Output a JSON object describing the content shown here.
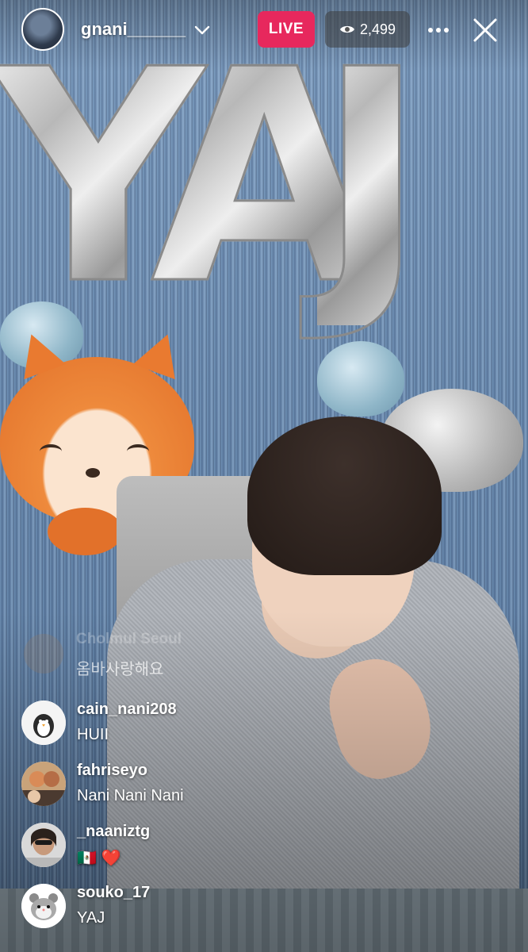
{
  "header": {
    "host_username": "gnani______",
    "live_label": "LIVE",
    "viewer_count": "2,499",
    "more_icon": "more-horizontal-icon",
    "close_icon": "close-icon",
    "dropdown_icon": "chevron-down-icon"
  },
  "colors": {
    "live_badge": "#e7285d",
    "text": "#ffffff"
  },
  "comments": {
    "faded": {
      "username": "Cholmul Seoul",
      "text": "옴바사랑해요"
    },
    "items": [
      {
        "username": "cain_nani208",
        "text": "HUII",
        "avatar": "penguin-avatar"
      },
      {
        "username": "fahriseyo",
        "text": "Nani Nani Nani",
        "avatar": "photo-avatar"
      },
      {
        "username": "_naaniztg",
        "text": "🇲🇽 ❤️",
        "avatar": "photo-avatar"
      },
      {
        "username": "souko_17",
        "text": "YAJ",
        "avatar": "hamster-avatar"
      }
    ]
  },
  "scene": {
    "balloon_letters": "YAJ"
  }
}
